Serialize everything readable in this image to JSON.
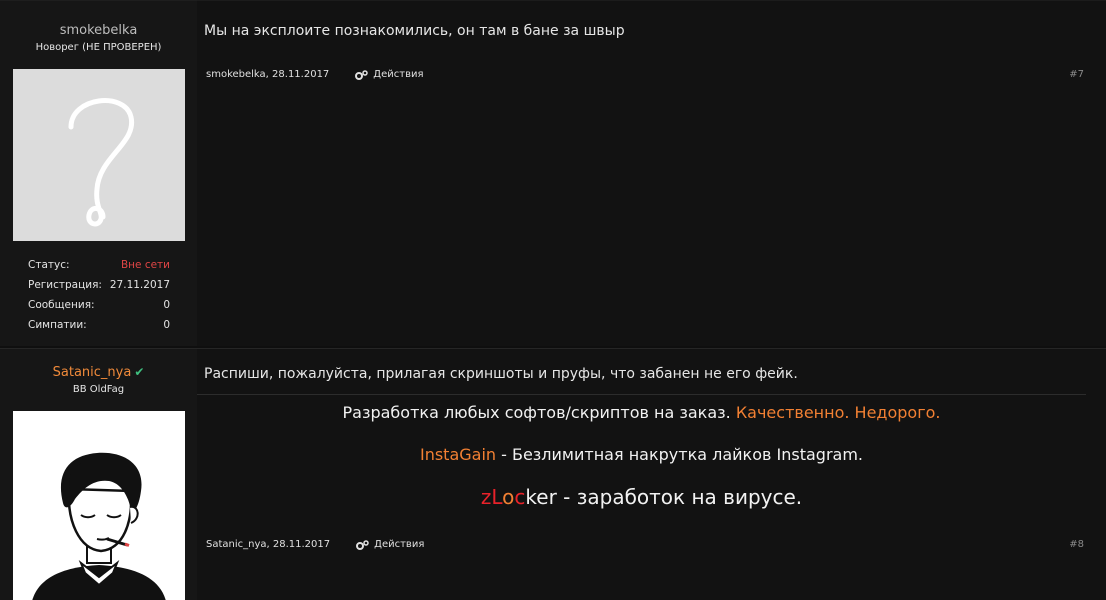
{
  "posts": [
    {
      "author": "smokebelka",
      "user_title": "Новорег (НЕ ПРОВЕРЕН)",
      "stats": [
        {
          "label": "Статус:",
          "value": "Вне сети"
        },
        {
          "label": "Регистрация:",
          "value": "27.11.2017"
        },
        {
          "label": "Сообщения:",
          "value": "0"
        },
        {
          "label": "Симпатии:",
          "value": "0"
        }
      ],
      "message": "Мы на эксплоите познакомились, он там в бане за швыр",
      "meta_author_date": "smokebelka, 28.11.2017",
      "actions_label": "Действия",
      "post_number": "#7"
    },
    {
      "author": "Satanic_nya",
      "verified_icon": "check-icon",
      "user_title": "BB OldFag",
      "message": "Распиши, пожалуйста, прилагая скриншоты и пруфы, что забанен не его фейк.",
      "signature": {
        "line1_text": "Разработка любых софтов/скриптов на заказ. ",
        "line1_highlight": "Качественно. Недорого.",
        "line2_highlight": "InstaGain",
        "line2_text": " - Безлимитная накрутка лайков Instagram.",
        "line3_prefix_red1": "zL",
        "line3_prefix_orange": "o",
        "line3_prefix_red2": "c",
        "line3_prefix_plain": "ker",
        "line3_text": " - заработок на вирусе."
      },
      "meta_author_date": "Satanic_nya, 28.11.2017",
      "actions_label": "Действия",
      "post_number": "#8"
    }
  ],
  "colors": {
    "background": "#0f0f0f",
    "username_highlight": "#f08a3a",
    "offline": "#e04545",
    "accent_orange": "#f28033",
    "accent_red": "#e8222a",
    "verified": "#3fbf7f"
  }
}
